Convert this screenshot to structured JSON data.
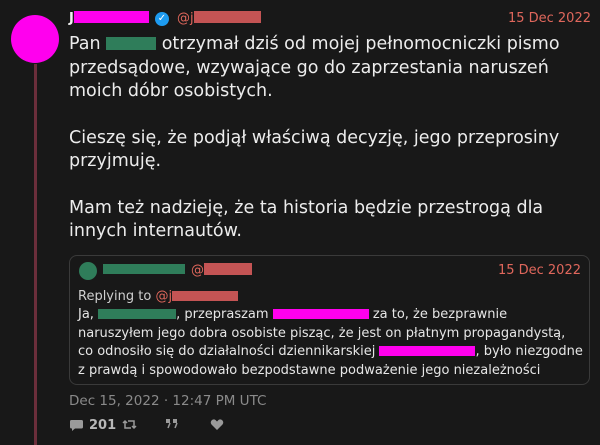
{
  "tweet": {
    "date": "15 Dec 2022",
    "paragraphs": [
      {
        "before": "Pan ",
        "after": " otrzymał dziś od mojej pełnomocniczki pismo przedsądowe, wzywające go do zaprzestania naruszeń moich dóbr osobistych."
      },
      {
        "text": "Cieszę się, że podjął właściwą decyzję, jego przeprosiny przyjmuję."
      },
      {
        "text": "Mam też nadzieję, że ta historia będzie przestrogą dla innych internautów."
      }
    ],
    "name_initial": "J",
    "handle_prefix": "@j",
    "timestamp": "Dec 15, 2022 · 12:47 PM UTC",
    "replies_count": "201"
  },
  "quote": {
    "handle_prefix": "@",
    "date": "15 Dec 2022",
    "replying_label": "Replying to ",
    "replying_handle": "@j",
    "text": {
      "part1": "Ja, ",
      "part2": ", przepraszam ",
      "part3": " za to, że bezprawnie naruszyłem jego dobra osobiste pisząc, że jest on płatnym propagandystą, co odnosiło się do działalności dziennikarskiej ",
      "part4": ", było niezgodne z prawdą i spowodowało bezpodstawne podważenie jego niezależności"
    }
  },
  "colors": {
    "accent": "#e0675c",
    "redaction_magenta": "#ff00ee",
    "redaction_green": "#2f7d5a",
    "verified": "#1d9bf0"
  },
  "icons": [
    "comment-icon",
    "retweet-icon",
    "quote-icon",
    "like-icon",
    "verified-icon"
  ]
}
